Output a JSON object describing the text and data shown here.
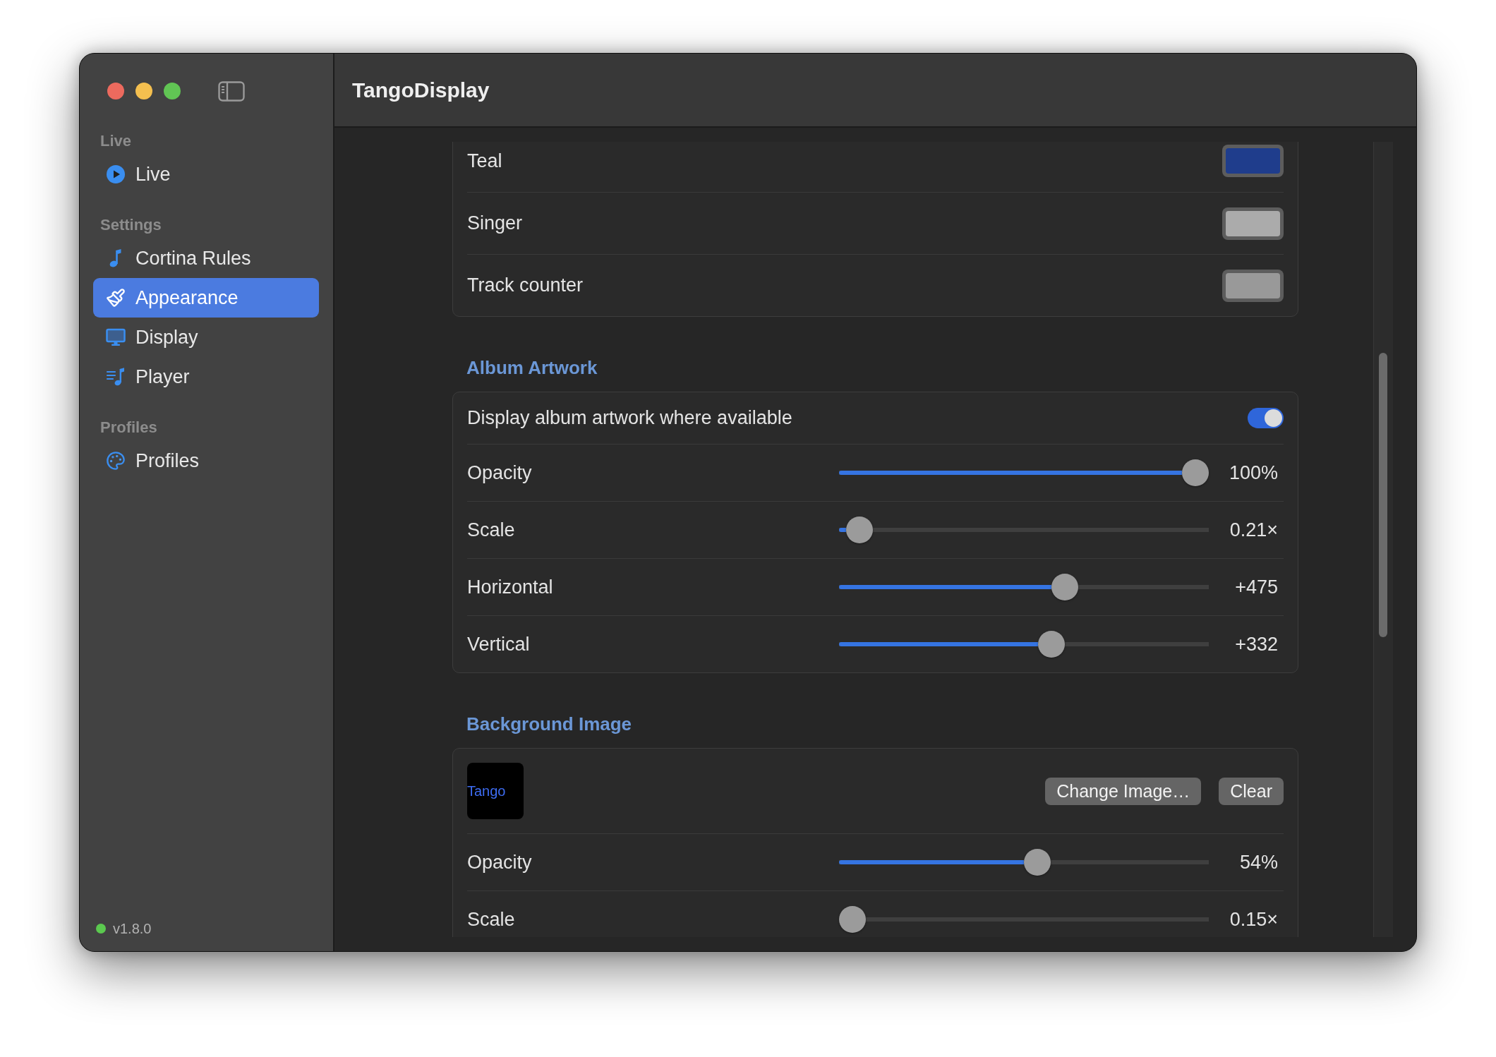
{
  "window": {
    "title": "TangoDisplay"
  },
  "sidebar": {
    "sections": [
      {
        "header": "Live",
        "items": [
          {
            "label": "Live",
            "selected": false
          }
        ]
      },
      {
        "header": "Settings",
        "items": [
          {
            "label": "Cortina Rules",
            "selected": false
          },
          {
            "label": "Appearance",
            "selected": true
          },
          {
            "label": "Display",
            "selected": false
          },
          {
            "label": "Player",
            "selected": false
          }
        ]
      },
      {
        "header": "Profiles",
        "items": [
          {
            "label": "Profiles",
            "selected": false
          }
        ]
      }
    ],
    "version": "v1.8.0"
  },
  "color_rows": {
    "rows": [
      {
        "label": "Teal",
        "color": "#1f3d8c"
      },
      {
        "label": "Singer",
        "color": "#ababab"
      },
      {
        "label": "Track counter",
        "color": "#999999"
      }
    ]
  },
  "album_artwork": {
    "heading": "Album Artwork",
    "toggle": {
      "label": "Display album artwork where available",
      "on": true
    },
    "sliders": [
      {
        "label": "Opacity",
        "level": 1,
        "reading": "100%"
      },
      {
        "label": "Scale",
        "level": 0.02,
        "reading": "0.21×"
      },
      {
        "label": "Horizontal",
        "level": 0.62,
        "reading": "+475"
      },
      {
        "label": "Vertical",
        "level": 0.58,
        "reading": "+332"
      }
    ]
  },
  "background_image": {
    "heading": "Background Image",
    "preview_text": "Tango",
    "buttons": [
      "Change Image…",
      "Clear"
    ],
    "sliders": [
      {
        "label": "Opacity",
        "level": 0.54,
        "reading": "54%"
      },
      {
        "label": "Scale",
        "level": 0,
        "reading": "0.15×"
      }
    ]
  }
}
